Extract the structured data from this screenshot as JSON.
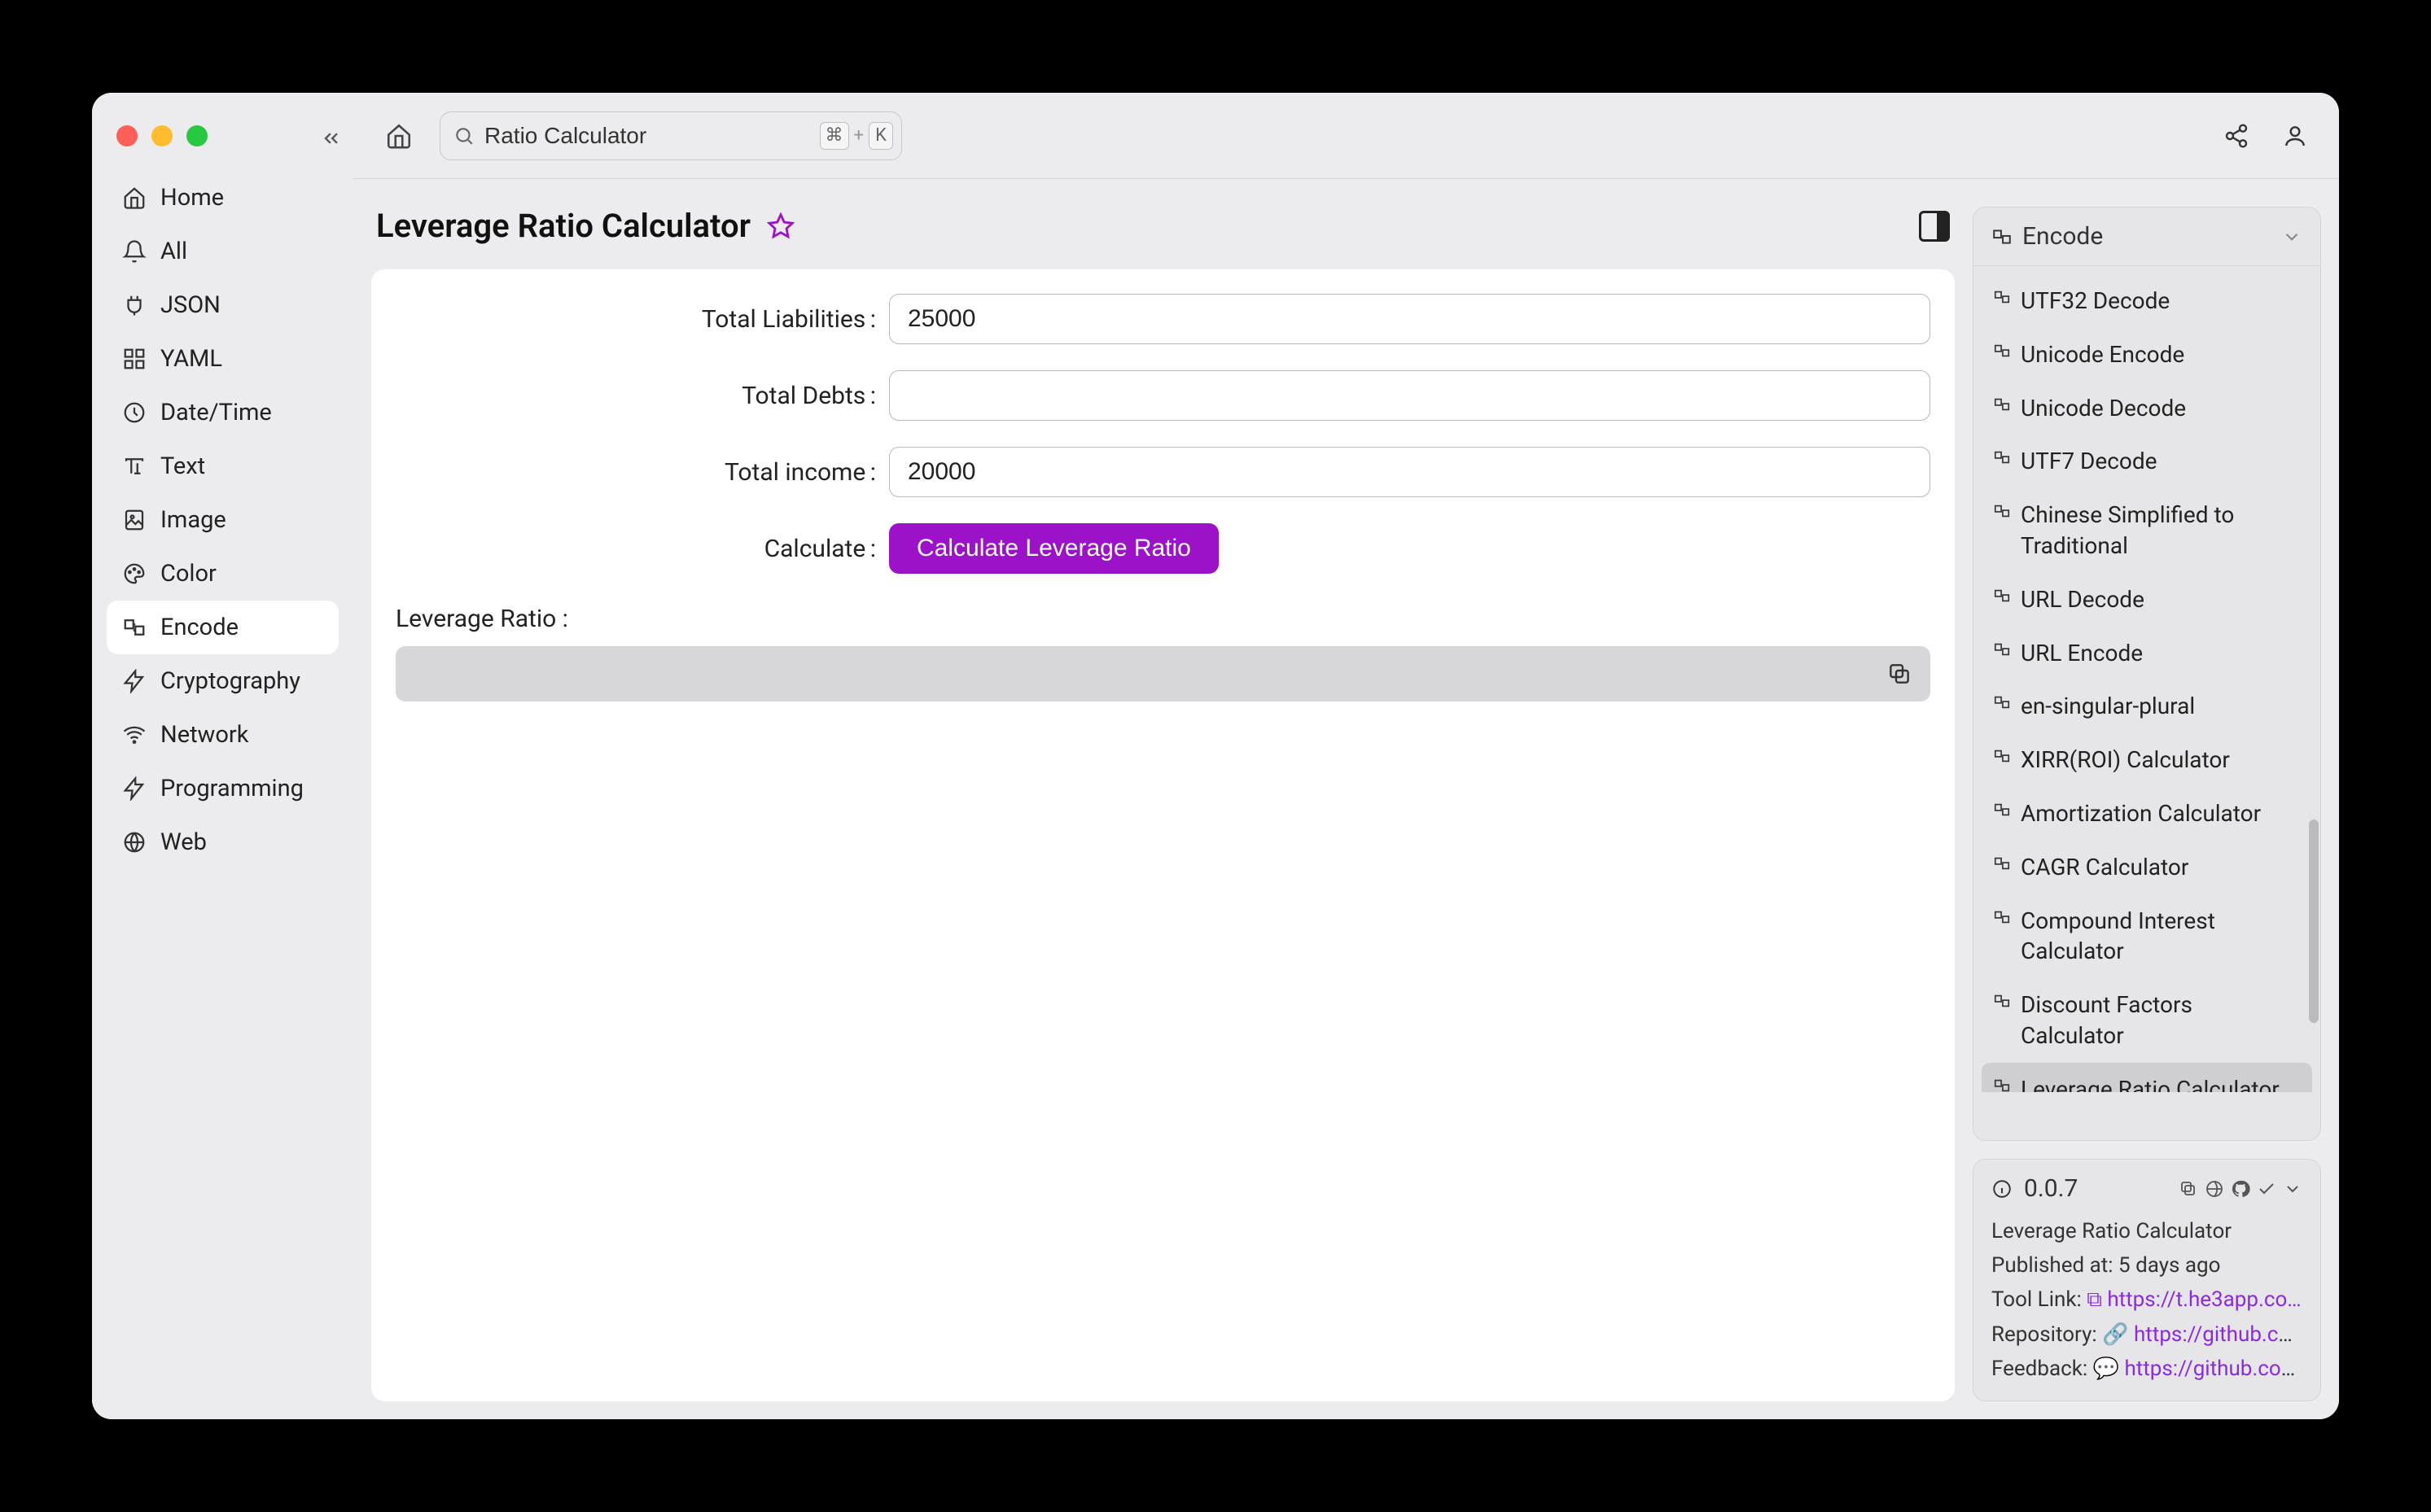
{
  "search": {
    "value": "Ratio Calculator",
    "kbd1": "⌘",
    "kbd_plus": "+",
    "kbd2": "K"
  },
  "sidebar": {
    "items": [
      {
        "label": "Home"
      },
      {
        "label": "All"
      },
      {
        "label": "JSON"
      },
      {
        "label": "YAML"
      },
      {
        "label": "Date/Time"
      },
      {
        "label": "Text"
      },
      {
        "label": "Image"
      },
      {
        "label": "Color"
      },
      {
        "label": "Encode"
      },
      {
        "label": "Cryptography"
      },
      {
        "label": "Network"
      },
      {
        "label": "Programming"
      },
      {
        "label": "Web"
      }
    ],
    "active_index": 8
  },
  "page": {
    "title": "Leverage Ratio Calculator"
  },
  "form": {
    "total_liabilities_label": "Total Liabilities",
    "total_liabilities_value": "25000",
    "total_debts_label": "Total Debts",
    "total_debts_value": "",
    "total_income_label": "Total income",
    "total_income_value": "20000",
    "calculate_label": "Calculate",
    "calculate_button": "Calculate Leverage Ratio",
    "result_label": "Leverage Ratio :",
    "result_value": ""
  },
  "right_panel": {
    "header": "Encode",
    "items": [
      {
        "label": "UTF32 Decode"
      },
      {
        "label": "Unicode Encode"
      },
      {
        "label": "Unicode Decode"
      },
      {
        "label": "UTF7 Decode"
      },
      {
        "label": "Chinese Simplified to Traditional"
      },
      {
        "label": "URL Decode"
      },
      {
        "label": "URL Encode"
      },
      {
        "label": "en-singular-plural"
      },
      {
        "label": "XIRR(ROI) Calculator"
      },
      {
        "label": "Amortization Calculator"
      },
      {
        "label": "CAGR Calculator"
      },
      {
        "label": "Compound Interest Calculator"
      },
      {
        "label": "Discount Factors Calculator"
      },
      {
        "label": "Leverage Ratio Calculator"
      }
    ],
    "active_index": 13
  },
  "info": {
    "version": "0.0.7",
    "name": "Leverage Ratio Calculator",
    "published_label": "Published at:",
    "published_value": "5 days ago",
    "tool_link_label": "Tool Link:",
    "tool_link_value": "https://t.he3app.co…",
    "repository_label": "Repository:",
    "repository_value": "https://github.com…",
    "feedback_label": "Feedback:",
    "feedback_value": "https://github.com/…"
  }
}
